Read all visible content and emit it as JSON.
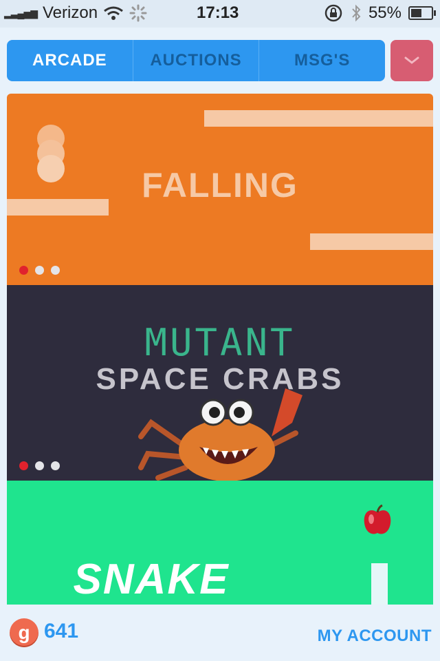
{
  "status_bar": {
    "signal": "▂▃▄▅▆",
    "carrier": "Verizon",
    "time": "17:13",
    "battery": "55%",
    "battery_level": 0.55
  },
  "nav": {
    "tabs": [
      {
        "label": "ARCADE",
        "active": true
      },
      {
        "label": "AUCTIONS",
        "active": false
      },
      {
        "label": "MSG'S",
        "active": false
      }
    ],
    "menu_icon": "chevron-down-icon"
  },
  "games": [
    {
      "title": "FALLING",
      "color": "#ed7a23",
      "slide_index": 0,
      "slide_count": 3
    },
    {
      "title_line1": "MUTANT",
      "title_line2": "SPACE CRABS",
      "color": "#2e2c3d",
      "slide_index": 0,
      "slide_count": 3
    },
    {
      "title": "SNAKE",
      "color": "#1fe48e"
    }
  ],
  "footer": {
    "coin_letter": "g",
    "coin_count": "641",
    "account_label": "MY ACCOUNT"
  },
  "colors": {
    "accent": "#2d97f0",
    "menu_button": "#d75d72",
    "active_dot": "#e0222d"
  }
}
